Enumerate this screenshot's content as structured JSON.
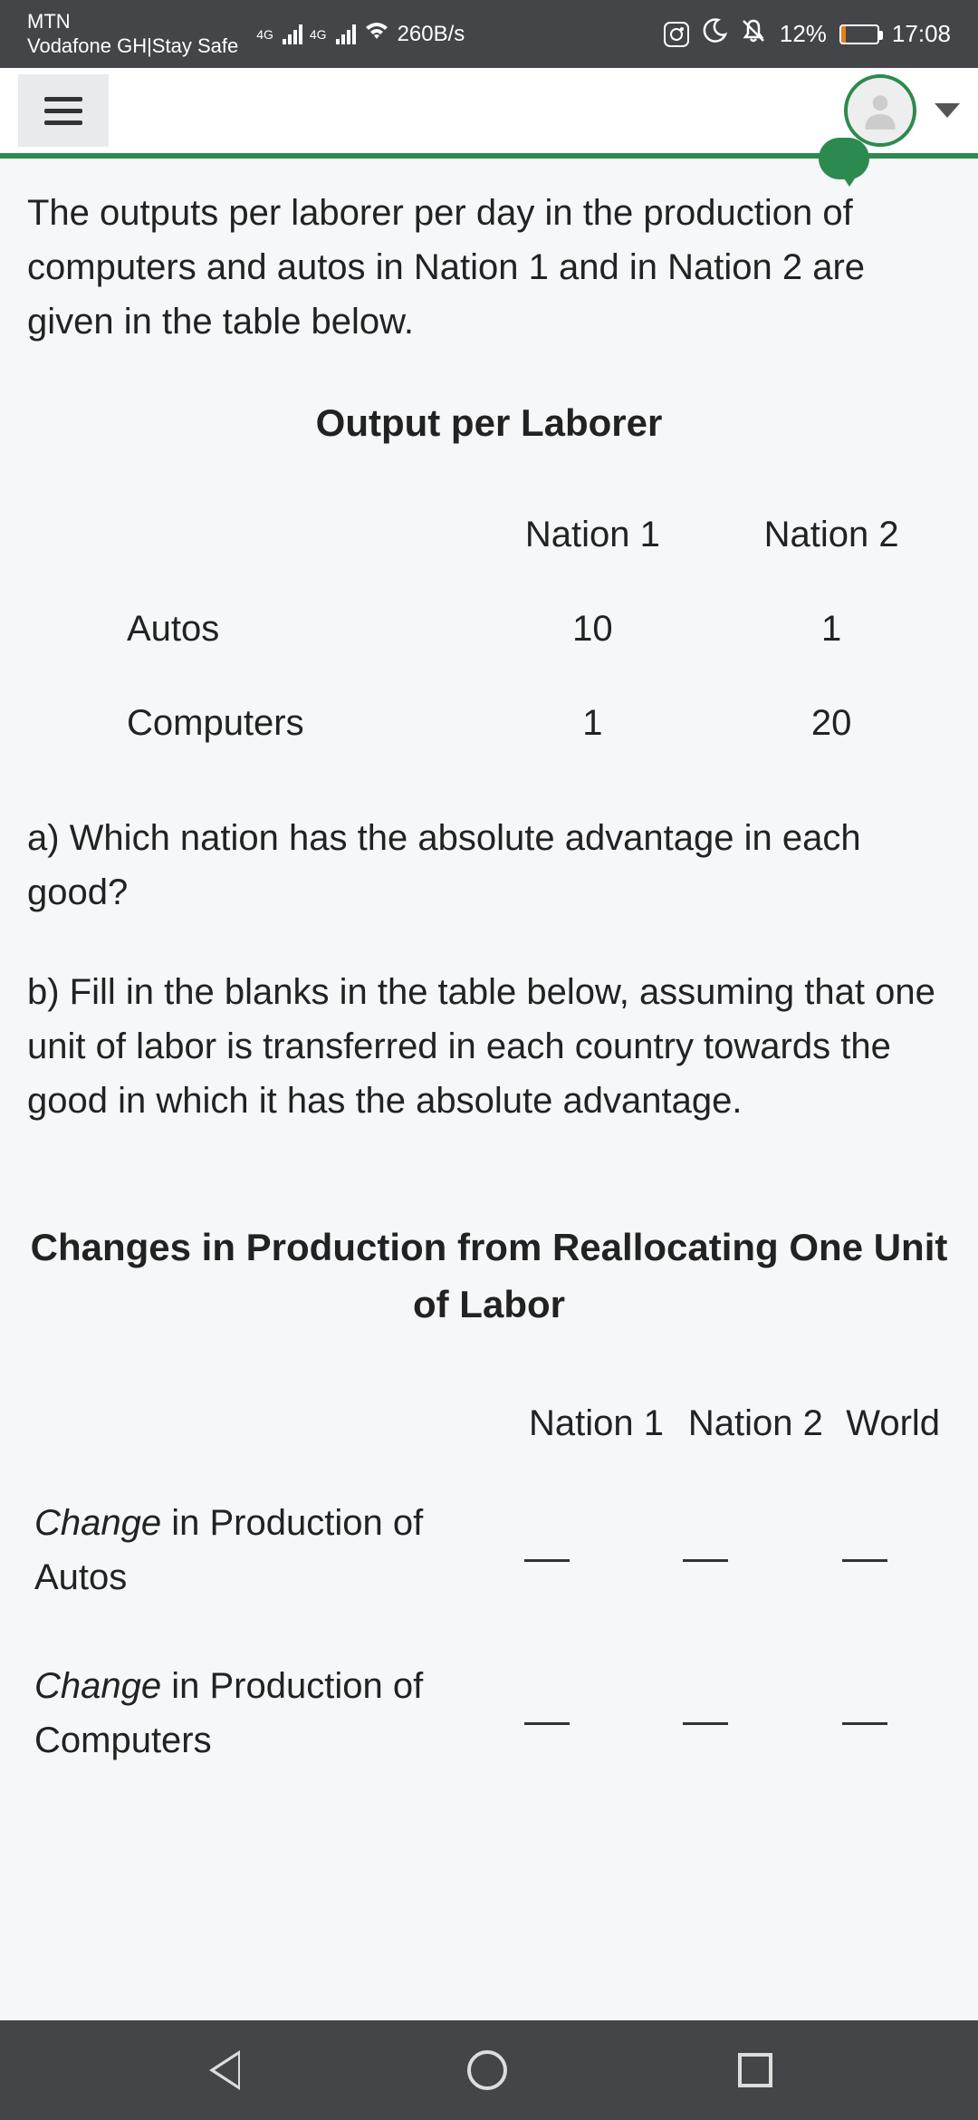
{
  "status": {
    "carrier1": "MTN",
    "carrier2": "Vodafone GH|Stay Safe",
    "net_label": "4G",
    "speed": "260B/s",
    "battery_pct": "12%",
    "time": "17:08"
  },
  "content": {
    "intro": "The outputs per laborer per day in the production of computers and autos in Nation 1 and in Nation 2 are given in the table below.",
    "table1": {
      "title": "Output per Laborer",
      "col1": "Nation 1",
      "col2": "Nation 2",
      "rows": [
        {
          "label": "Autos",
          "n1": "10",
          "n2": "1"
        },
        {
          "label": "Computers",
          "n1": "1",
          "n2": "20"
        }
      ]
    },
    "qa": "a) Which nation has the absolute advantage in each good?",
    "qb": "b) Fill in the blanks in the table below, assuming that one unit of labor is transferred in each country towards the good in which it has the absolute advantage.",
    "table2": {
      "title": "Changes in Production from Reallocating One Unit of Labor",
      "col1": "Nation 1",
      "col2": "Nation 2",
      "col3": "World",
      "rows": [
        {
          "prefix": "Change",
          "rest": " in Production of Autos"
        },
        {
          "prefix": "Change",
          "rest": " in Production of Computers"
        }
      ]
    }
  }
}
